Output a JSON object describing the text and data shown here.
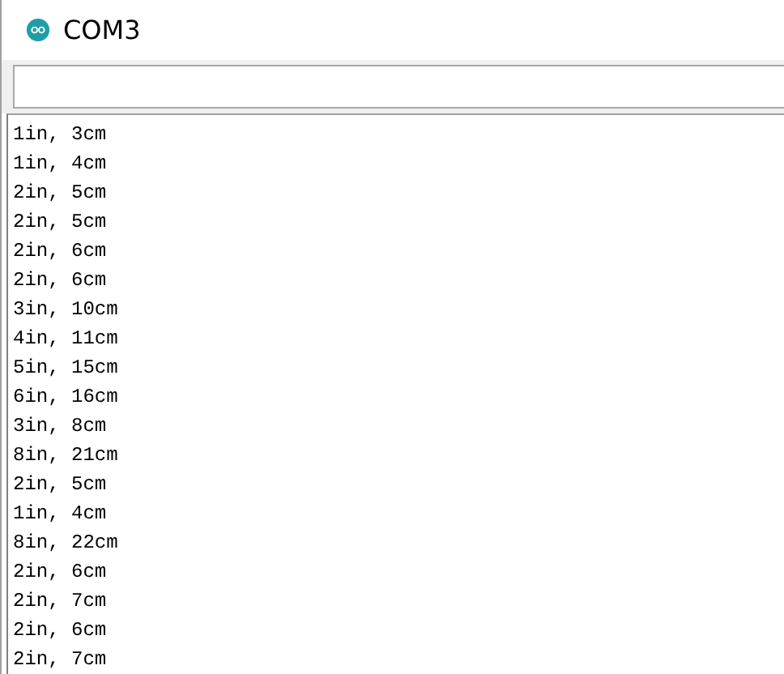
{
  "window": {
    "title": "COM3"
  },
  "output_lines": [
    "1in, 3cm",
    "1in, 4cm",
    "2in, 5cm",
    "2in, 5cm",
    "2in, 6cm",
    "2in, 6cm",
    "3in, 10cm",
    "4in, 11cm",
    "5in, 15cm",
    "6in, 16cm",
    "3in, 8cm",
    "8in, 21cm",
    "2in, 5cm",
    "1in, 4cm",
    "8in, 22cm",
    "2in, 6cm",
    "2in, 7cm",
    "2in, 6cm",
    "2in, 7cm"
  ]
}
